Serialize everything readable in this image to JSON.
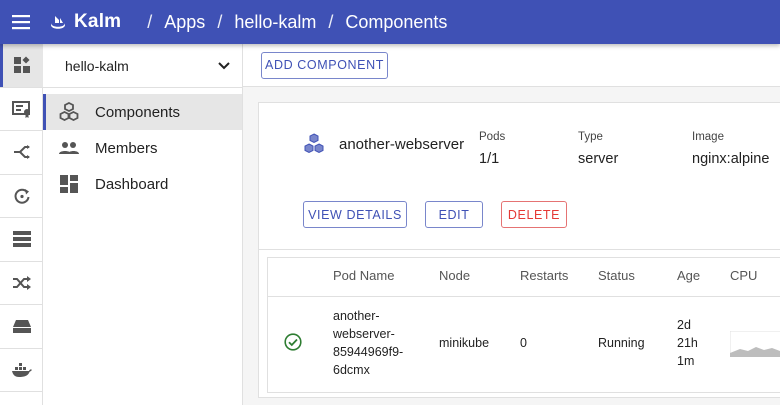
{
  "appbar": {
    "logo_text": "Kalm",
    "breadcrumbs": [
      "Apps",
      "hello-kalm",
      "Components"
    ],
    "separator": "/"
  },
  "rail": {
    "items": [
      {
        "icon": "apps-icon",
        "active": true
      },
      {
        "icon": "certificate-icon"
      },
      {
        "icon": "routes-icon"
      },
      {
        "icon": "sync-icon"
      },
      {
        "icon": "nodes-icon"
      },
      {
        "icon": "shuffle-icon"
      },
      {
        "icon": "storage-icon"
      },
      {
        "icon": "docker-icon"
      }
    ]
  },
  "sidebar": {
    "app_name": "hello-kalm",
    "items": [
      {
        "label": "Components",
        "icon": "cubes-icon",
        "active": true
      },
      {
        "label": "Members",
        "icon": "people-icon"
      },
      {
        "label": "Dashboard",
        "icon": "dashboard-icon"
      }
    ]
  },
  "toolbar": {
    "add_label": "ADD COMPONENT"
  },
  "component": {
    "name": "another-webserver",
    "pods_label": "Pods",
    "pods_value": "1/1",
    "type_label": "Type",
    "type_value": "server",
    "image_label": "Image",
    "image_value": "nginx:alpine",
    "view_details_label": "VIEW DETAILS",
    "edit_label": "EDIT",
    "delete_label": "DELETE"
  },
  "pods_table": {
    "columns": [
      "Pod Name",
      "Node",
      "Restarts",
      "Status",
      "Age",
      "CPU"
    ],
    "rows": [
      {
        "pod_name_lines": [
          "another-",
          "webserver-",
          "85944969f9-",
          "6dcmx"
        ],
        "node": "minikube",
        "restarts": "0",
        "status": "Running",
        "age_lines": [
          "2d",
          "21h",
          "1m"
        ],
        "status_icon": "check-circle-icon"
      }
    ]
  },
  "colors": {
    "primary": "#3f51b5",
    "danger": "#e53935",
    "success": "#2e7d32"
  }
}
